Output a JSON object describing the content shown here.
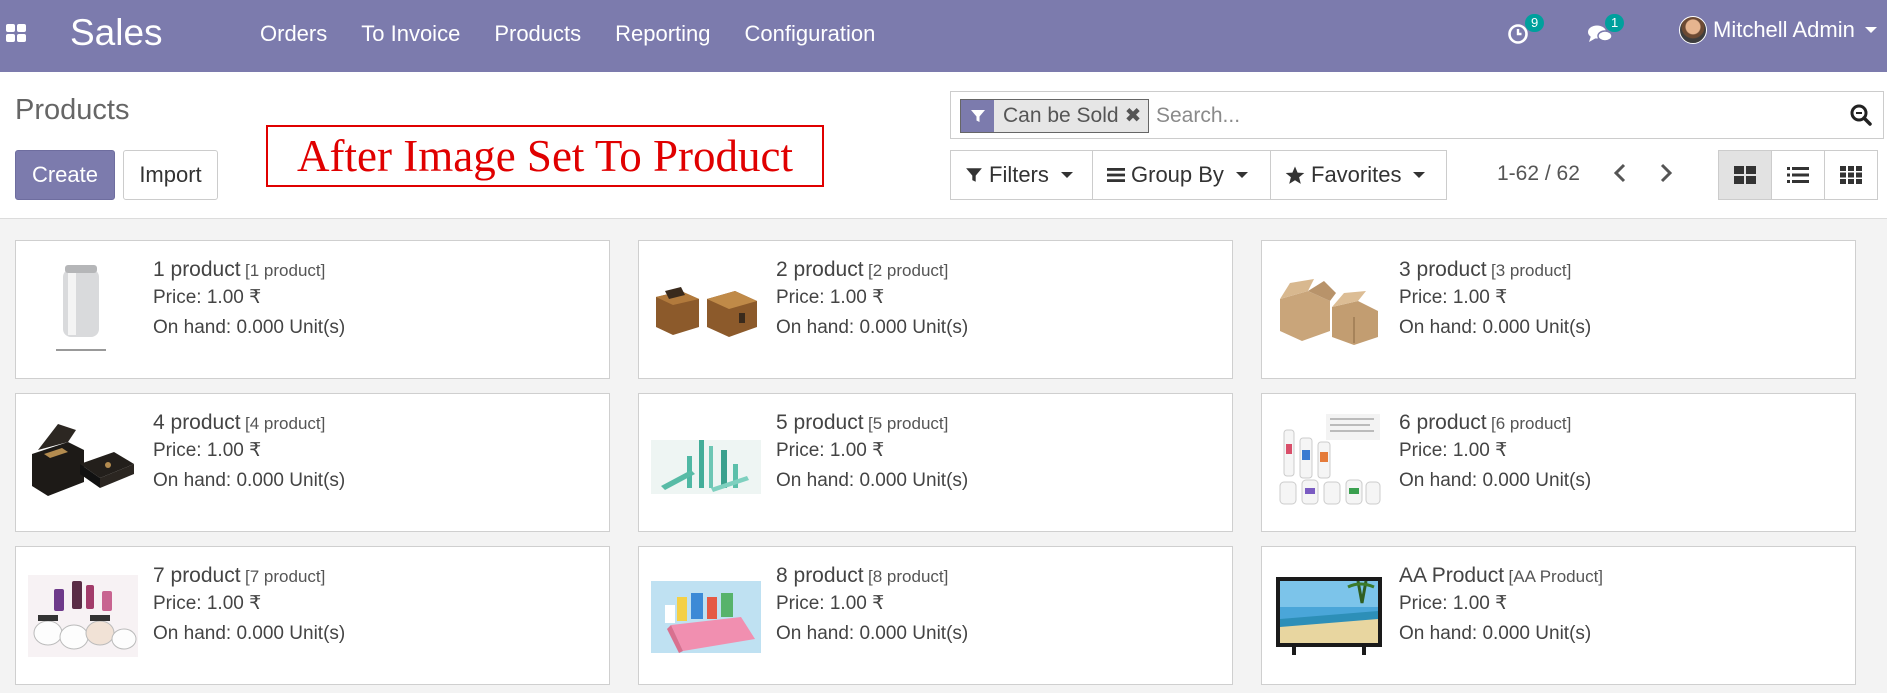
{
  "navbar": {
    "brand": "Sales",
    "menu": [
      "Orders",
      "To Invoice",
      "Products",
      "Reporting",
      "Configuration"
    ],
    "activity_count": "9",
    "messages_count": "1",
    "user_name": "Mitchell Admin"
  },
  "control_panel": {
    "breadcrumb": "Products",
    "create_label": "Create",
    "import_label": "Import",
    "annotation": "After Image Set To Product",
    "search": {
      "facet_label": "Can be Sold",
      "facet_remove": "✖",
      "placeholder": "Search..."
    },
    "filters_label": "Filters",
    "group_by_label": "Group By",
    "favorites_label": "Favorites",
    "pager": "1-62 / 62"
  },
  "products": [
    {
      "name": "1 product",
      "code": "[1 product]",
      "price": "Price: 1.00 ₹",
      "onhand": "On hand: 0.000 Unit(s)",
      "image": "aluminum-can"
    },
    {
      "name": "2 product",
      "code": "[2 product]",
      "price": "Price: 1.00 ₹",
      "onhand": "On hand: 0.000 Unit(s)",
      "image": "wooden-boxes"
    },
    {
      "name": "3 product",
      "code": "[3 product]",
      "price": "Price: 1.00 ₹",
      "onhand": "On hand: 0.000 Unit(s)",
      "image": "cardboard-boxes"
    },
    {
      "name": "4 product",
      "code": "[4 product]",
      "price": "Price: 1.00 ₹",
      "onhand": "On hand: 0.000 Unit(s)",
      "image": "black-gift-box"
    },
    {
      "name": "5 product",
      "code": "[5 product]",
      "price": "Price: 1.00 ₹",
      "onhand": "On hand: 0.000 Unit(s)",
      "image": "cosmetic-tubes"
    },
    {
      "name": "6 product",
      "code": "[6 product]",
      "price": "Price: 1.00 ₹",
      "onhand": "On hand: 0.000 Unit(s)",
      "image": "spray-bottles"
    },
    {
      "name": "7 product",
      "code": "[7 product]",
      "price": "Price: 1.00 ₹",
      "onhand": "On hand: 0.000 Unit(s)",
      "image": "cosmetic-jars"
    },
    {
      "name": "8 product",
      "code": "[8 product]",
      "price": "Price: 1.00 ₹",
      "onhand": "On hand: 0.000 Unit(s)",
      "image": "pink-gift-box"
    },
    {
      "name": "AA Product",
      "code": "[AA Product]",
      "price": "Price: 1.00 ₹",
      "onhand": "On hand: 0.000 Unit(s)",
      "image": "television"
    }
  ],
  "colors": {
    "primary": "#7c7bad",
    "badge": "#00a09d",
    "annotation": "#e00000"
  }
}
